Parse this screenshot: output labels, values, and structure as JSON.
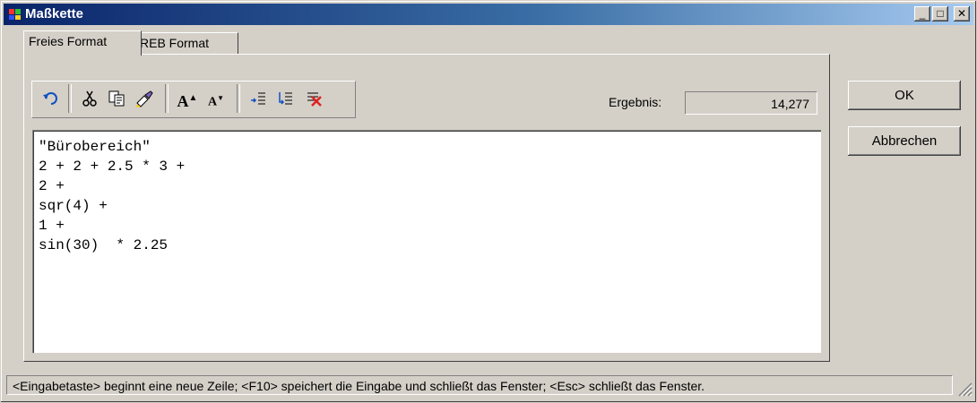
{
  "window": {
    "title": "Maßkette",
    "controls": {
      "minimize": "_",
      "maximize": "□",
      "close": "✕"
    }
  },
  "tabs": [
    {
      "label": "Freies Format",
      "active": true
    },
    {
      "label": "REB Format",
      "active": false
    }
  ],
  "toolbar": {
    "icons": [
      "undo-icon",
      "cut-icon",
      "copy-icon",
      "paste-icon",
      "font-increase-icon",
      "font-decrease-icon",
      "insert-line-icon",
      "line-break-icon",
      "clear-icon"
    ]
  },
  "result": {
    "label": "Ergebnis:",
    "value": "14,277"
  },
  "editor": {
    "content": "\"Bürobereich\"\n2 + 2 + 2.5 * 3 +\n2 +\nsqr(4) +\n1 +\nsin(30)  * 2.25"
  },
  "buttons": {
    "ok": "OK",
    "cancel": "Abbrechen"
  },
  "status": {
    "text": "<Eingabetaste> beginnt eine neue Zeile; <F10> speichert die Eingabe und schließt das Fenster; <Esc> schließt das Fenster."
  },
  "colors": {
    "titlebar_start": "#0a246a",
    "titlebar_end": "#a6caf0",
    "face": "#d4d0c8"
  }
}
